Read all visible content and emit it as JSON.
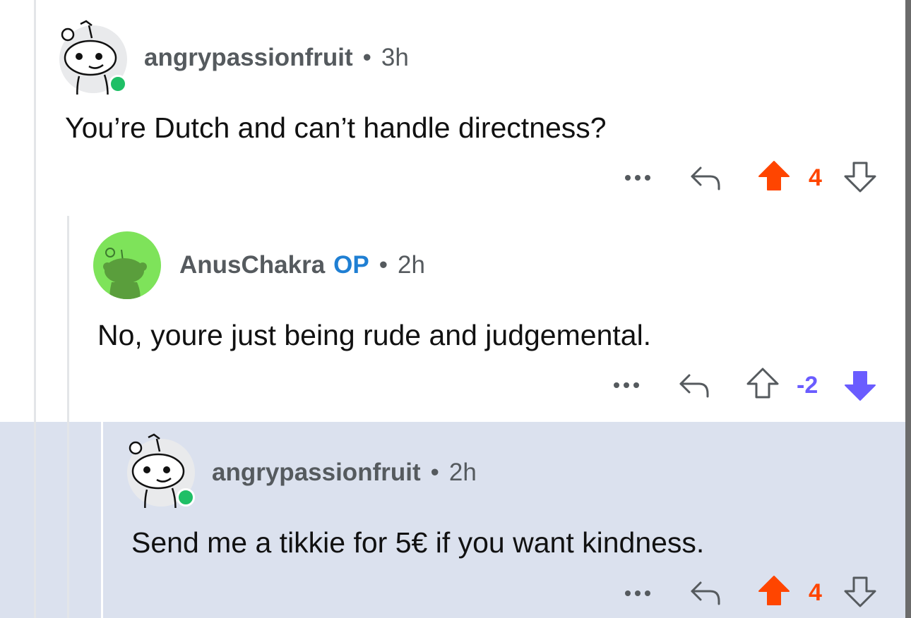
{
  "colors": {
    "upvote": "#ff4500",
    "downvote": "#6a5cff",
    "op_badge": "#1f7fd3",
    "online": "#1fbf66",
    "highlight_bg": "#dbe1ee"
  },
  "comments": [
    {
      "username": "angrypassionfruit",
      "separator": "•",
      "time": "3h",
      "text": "You’re Dutch and can’t handle directness?",
      "score": "4",
      "vote_state": "upvoted"
    },
    {
      "username": "AnusChakra",
      "op_badge": "OP",
      "separator": "•",
      "time": "2h",
      "text": "No, youre just being rude and judgemental.",
      "score": "-2",
      "vote_state": "downvoted"
    },
    {
      "username": "angrypassionfruit",
      "separator": "•",
      "time": "2h",
      "text": "Send me a tikkie for 5€ if you want kindness.",
      "score": "4",
      "vote_state": "upvoted"
    }
  ],
  "icons": {
    "more": "more-options-icon",
    "reply": "reply-arrow-icon",
    "upvote": "upvote-arrow-icon",
    "downvote": "downvote-arrow-icon"
  }
}
